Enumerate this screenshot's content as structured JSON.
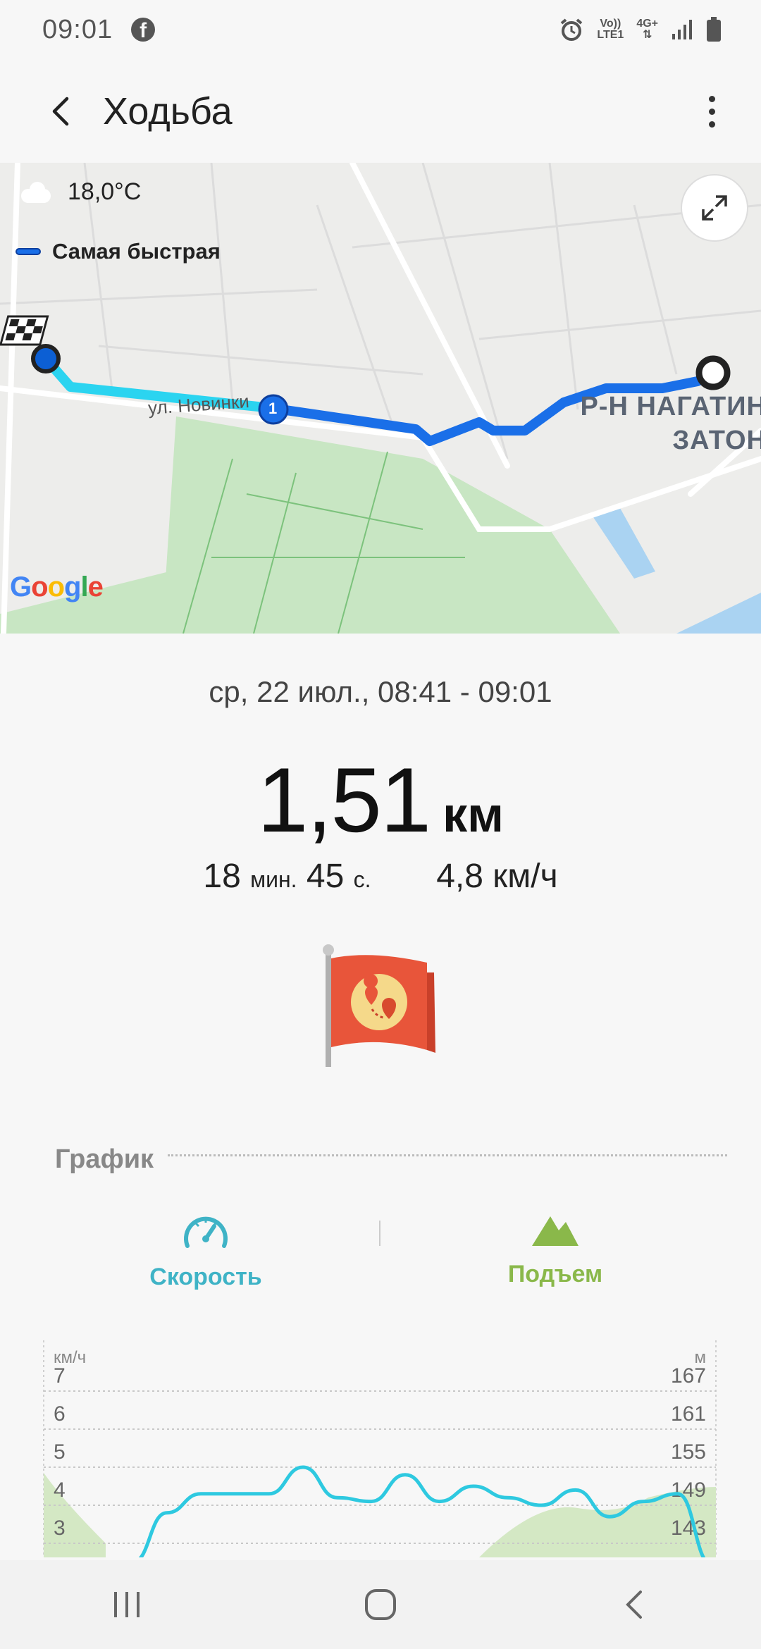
{
  "status_bar": {
    "time": "09:01",
    "network_top": "Vo))",
    "network_bottom": "LTE1",
    "network_type": "4G+"
  },
  "header": {
    "title": "Ходьба"
  },
  "map": {
    "weather": "18,0°C",
    "route_legend": "Самая быстрая",
    "street": "ул. Новинки",
    "district_line1": "Р-Н НАГАТИН",
    "district_line2": "ЗАТОН",
    "marker_number": "1",
    "route_color": "#1a6fe8",
    "route_start_color": "#2bd4f0"
  },
  "summary": {
    "date_range": "ср, 22 июл., 08:41 - 09:01",
    "distance_value": "1,51",
    "distance_unit": "км",
    "duration_min": "18",
    "min_label": "мин.",
    "duration_sec": "45",
    "sec_label": "с.",
    "speed": "4,8 км/ч"
  },
  "graph": {
    "section_title": "График",
    "tab_speed": "Скорость",
    "tab_elevation": "Подъем",
    "speed_color": "#2ec9e0",
    "elevation_color": "#8ab84a"
  },
  "chart_data": {
    "type": "line",
    "y_left_label": "км/ч",
    "y_right_label": "м",
    "y_left_ticks": [
      "7",
      "6",
      "5",
      "4",
      "3"
    ],
    "y_right_ticks": [
      "167",
      "161",
      "155",
      "149",
      "143"
    ],
    "series": [
      {
        "values": [
          0,
          2.5,
          3.8,
          4.3,
          4.3,
          4.3,
          5.0,
          4.2,
          4.1,
          4.8,
          4.1,
          4.5,
          4.2,
          4.0,
          4.4,
          3.7,
          4.1,
          4.3,
          1.5
        ]
      }
    ]
  },
  "nav_bar": {
    "recents": "recents",
    "home": "home",
    "back": "back"
  }
}
